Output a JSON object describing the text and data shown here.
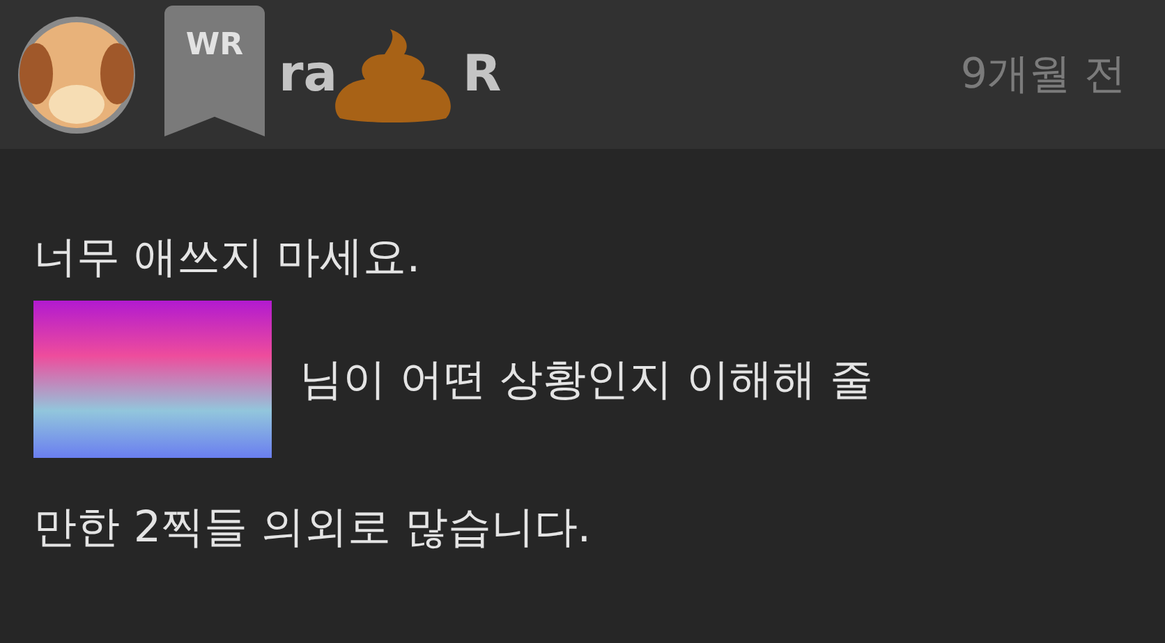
{
  "comment": {
    "badge": "WR",
    "author_start": "ra",
    "author_end": "R",
    "time": "9개월 전",
    "lines": [
      "너무 애쓰지 마세요."
    ],
    "message": [
      "님이 어떤 상황인지 이해해 줄",
      "만한 2찍들 의외로 많습니다."
    ]
  }
}
